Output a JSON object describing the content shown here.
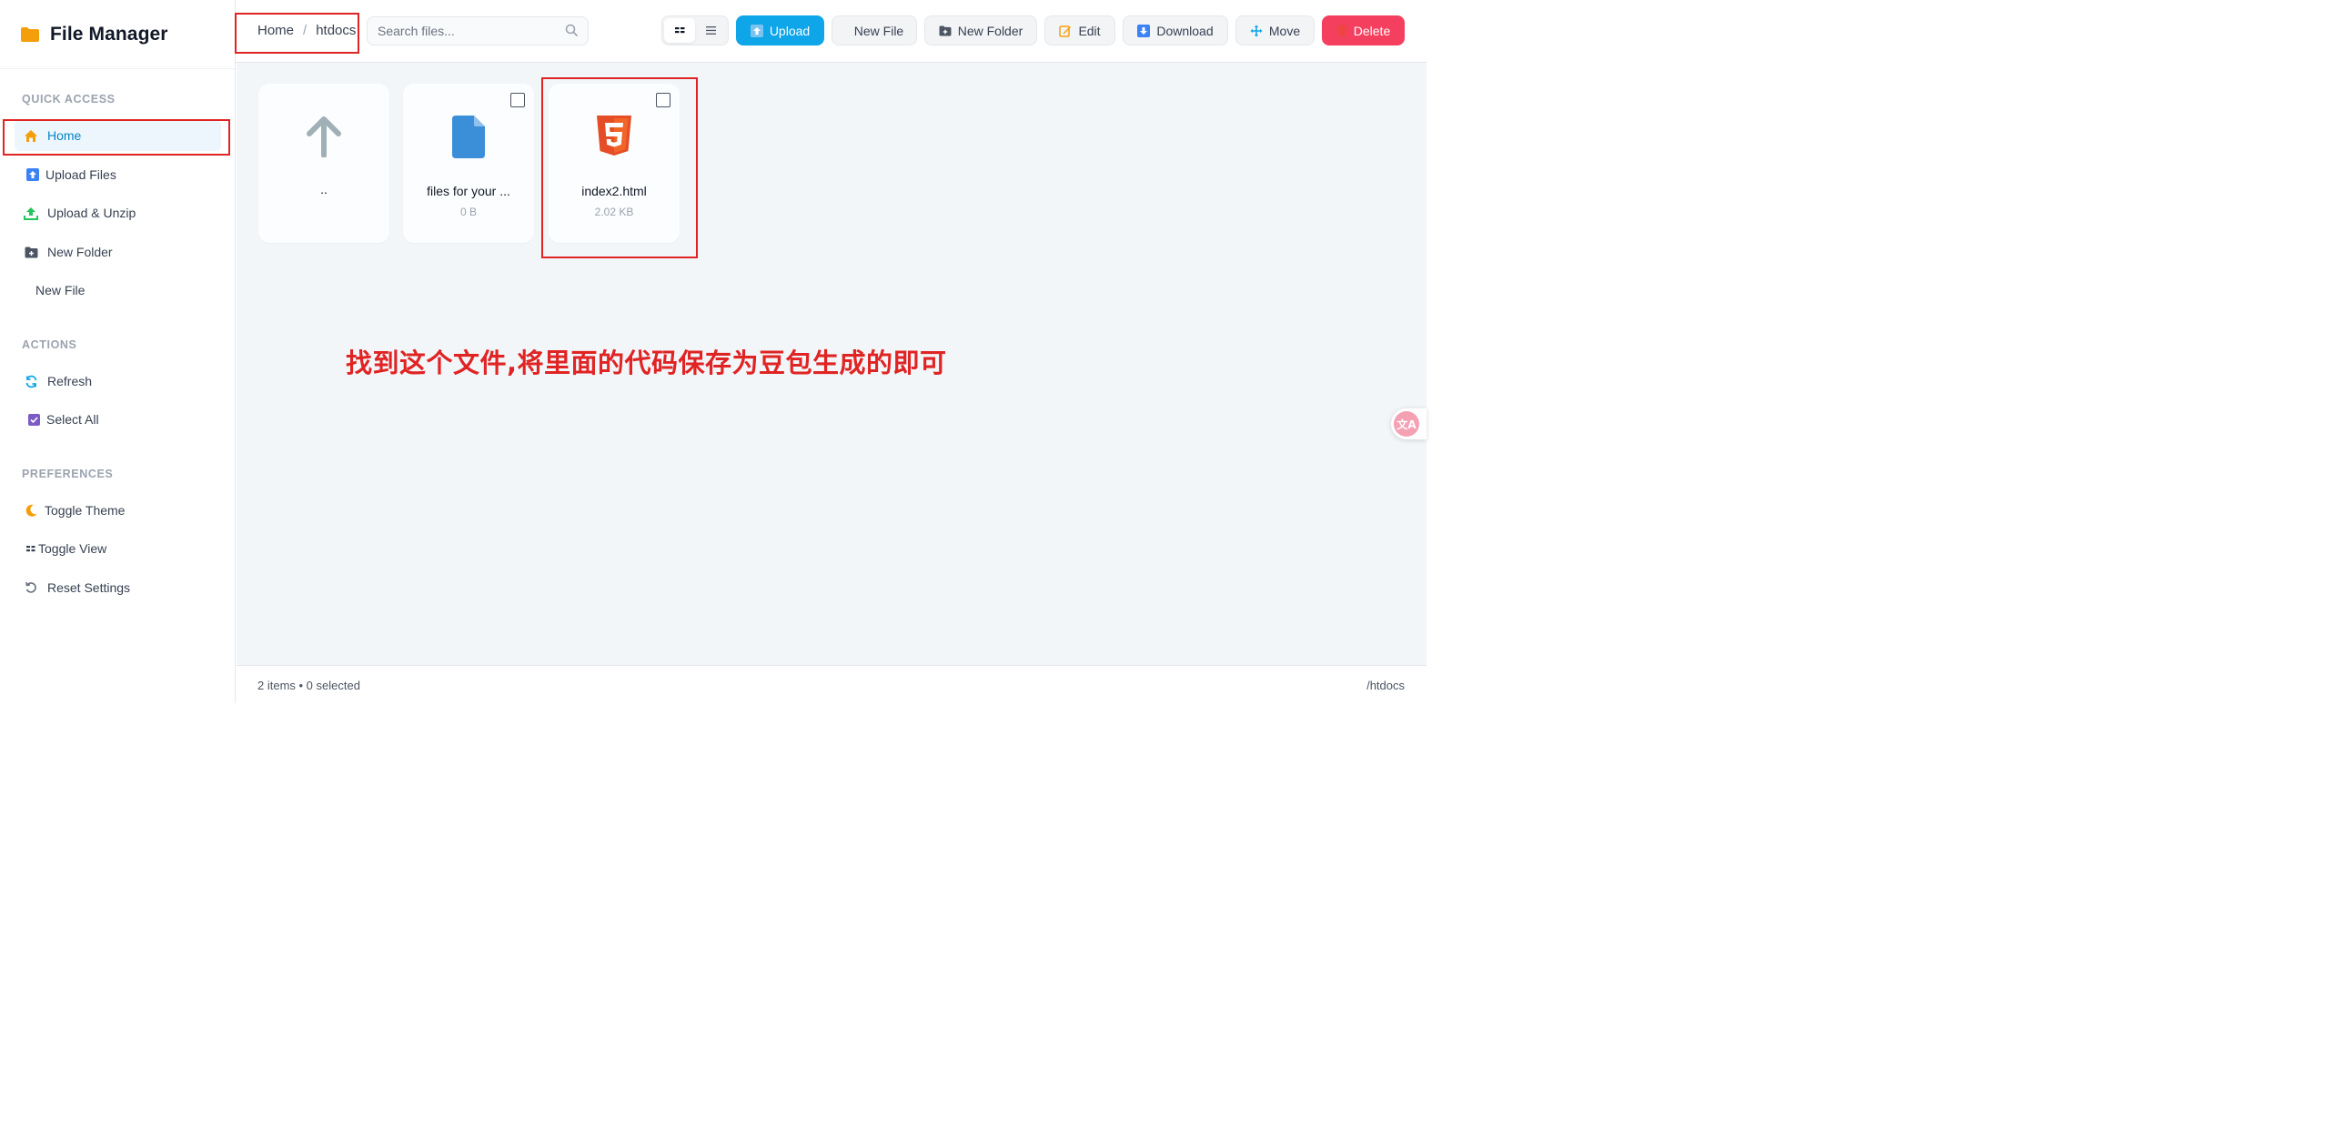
{
  "app": {
    "title": "File Manager"
  },
  "sidebar": {
    "sections": [
      {
        "label": "QUICK ACCESS"
      },
      {
        "label": "ACTIONS"
      },
      {
        "label": "PREFERENCES"
      }
    ],
    "items": [
      {
        "label": "Home",
        "icon": "home-icon",
        "active": true
      },
      {
        "label": "Upload Files",
        "icon": "upload-arrow-icon"
      },
      {
        "label": "Upload & Unzip",
        "icon": "upload-tray-icon"
      },
      {
        "label": "New Folder",
        "icon": "folder-plus-icon"
      },
      {
        "label": "New File",
        "icon": ""
      },
      {
        "label": "Refresh",
        "icon": "refresh-icon"
      },
      {
        "label": "Select All",
        "icon": "checkbox-checked-icon"
      },
      {
        "label": "Toggle Theme",
        "icon": "moon-icon"
      },
      {
        "label": "Toggle View",
        "icon": "grid-icon"
      },
      {
        "label": "Reset Settings",
        "icon": "reset-icon"
      }
    ]
  },
  "breadcrumb": {
    "items": [
      "Home",
      "htdocs"
    ],
    "separator": "/"
  },
  "search": {
    "placeholder": "Search files..."
  },
  "toolbar": {
    "upload": "Upload",
    "new_file": "New File",
    "new_folder": "New Folder",
    "edit": "Edit",
    "download": "Download",
    "move": "Move",
    "delete": "Delete"
  },
  "files": [
    {
      "name": "..",
      "size": "",
      "type": "parent"
    },
    {
      "name": "files for your ...",
      "size": "0 B",
      "type": "file"
    },
    {
      "name": "index2.html",
      "size": "2.02 KB",
      "type": "html"
    }
  ],
  "annotation": {
    "text": "找到这个文件,将里面的代码保存为豆包生成的即可",
    "color": "#e02424"
  },
  "status": {
    "summary": "2 items • 0 selected",
    "path": "/htdocs"
  },
  "translate_widget": {
    "glyph": "文A"
  },
  "colors": {
    "accent": "#0ea5e9",
    "danger": "#f43f5e",
    "folder": "#f59e0b",
    "html5": "#e44d26"
  }
}
